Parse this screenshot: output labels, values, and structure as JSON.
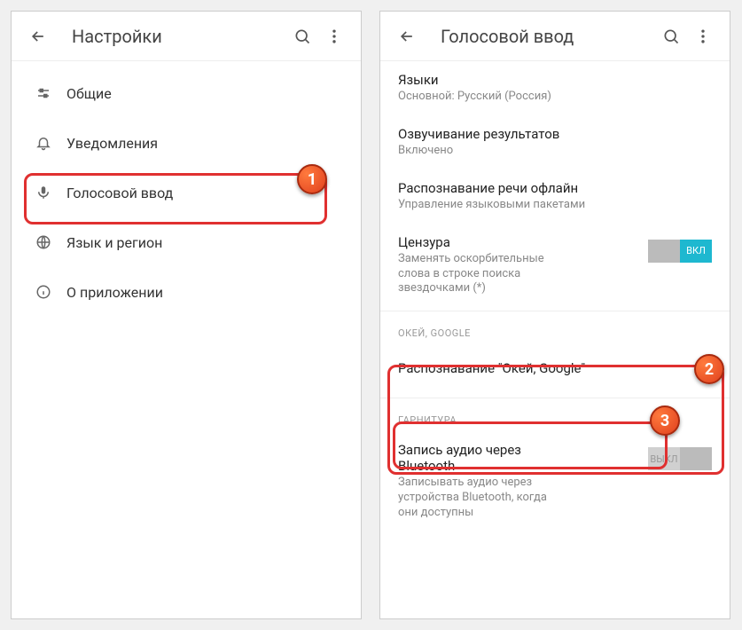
{
  "left": {
    "title": "Настройки",
    "items": [
      {
        "label": "Общие"
      },
      {
        "label": "Уведомления"
      },
      {
        "label": "Голосовой ввод"
      },
      {
        "label": "Язык и регион"
      },
      {
        "label": "О приложении"
      }
    ]
  },
  "right": {
    "title": "Голосовой ввод",
    "languages": {
      "title": "Языки",
      "sub": "Основной: Русский (Россия)"
    },
    "speak": {
      "title": "Озвучивание результатов",
      "sub": "Включено"
    },
    "offline": {
      "title": "Распознавание речи офлайн",
      "sub": "Управление языковыми пакетами"
    },
    "censor": {
      "title": "Цензура",
      "sub": "Заменять оскорбительные слова в строке поиска звездочками (*)",
      "toggle": "ВКЛ"
    },
    "ok_section": "ОКЕЙ, GOOGLE",
    "ok_detect": {
      "title": "Распознавание \"Окей, Google\""
    },
    "headset_section": "ГАРНИТУРА",
    "bt": {
      "title": "Запись аудио через Bluetooth",
      "sub": "Записывать аудио через устройства Bluetooth, когда они доступны",
      "toggle": "ВЫКЛ"
    }
  },
  "markers": {
    "m1": "1",
    "m2": "2",
    "m3": "3"
  }
}
